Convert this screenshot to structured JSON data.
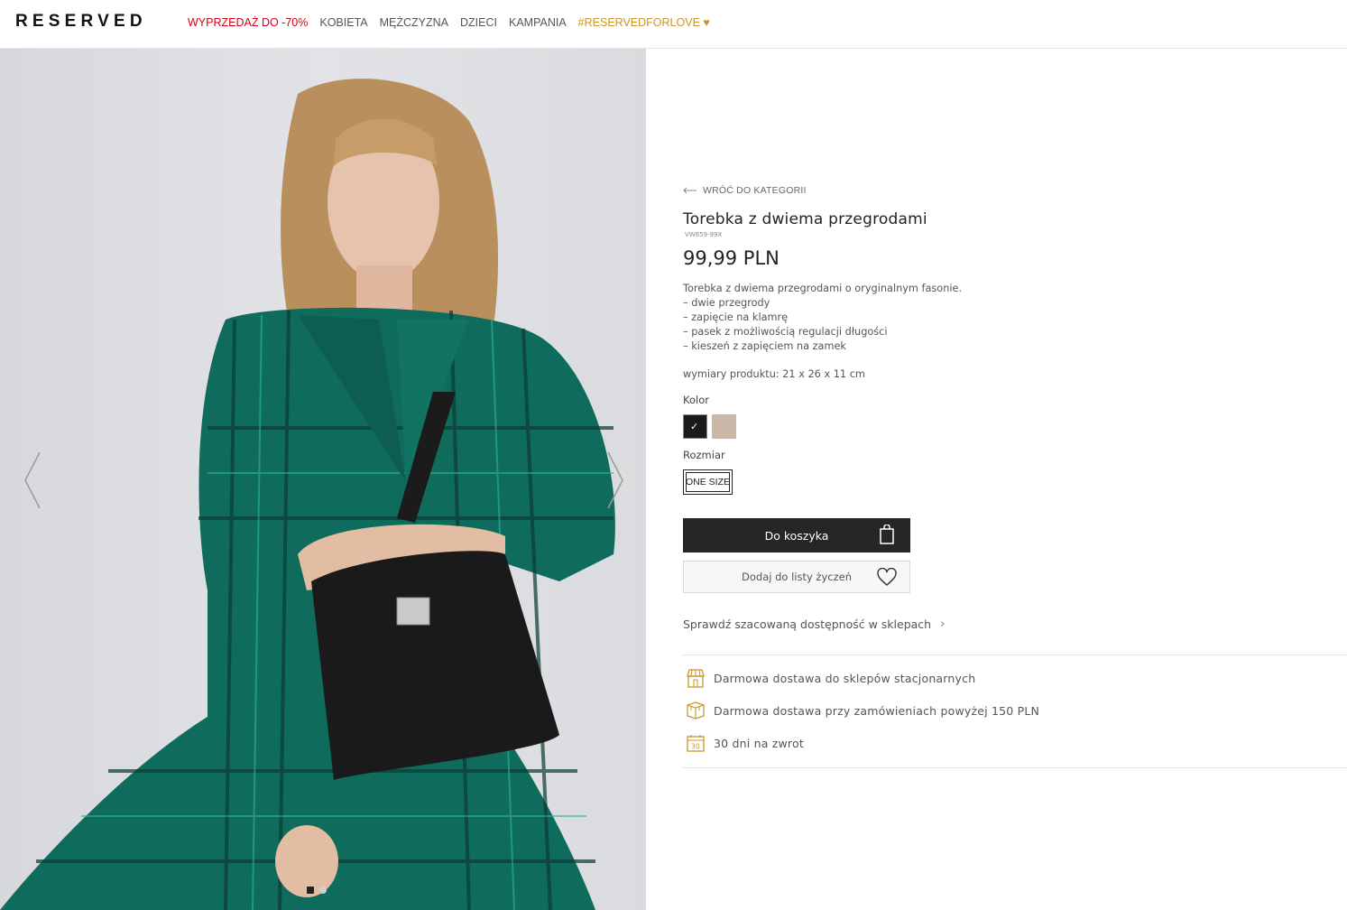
{
  "header": {
    "logo": "RESERVED",
    "nav": [
      {
        "label": "WYPRZEDAŻ DO -70%"
      },
      {
        "label": "KOBIETA"
      },
      {
        "label": "MĘŻCZYZNA"
      },
      {
        "label": "DZIECI"
      },
      {
        "label": "KAMPANIA"
      },
      {
        "label": "#RESERVEDFORLOVE ♥"
      }
    ]
  },
  "product": {
    "back_label": "WRÓĆ DO KATEGORII",
    "title": "Torebka z dwiema przegrodami",
    "sku": "VW659-99X",
    "price": "99,99 PLN",
    "description": [
      "Torebka z dwiema przegrodami o oryginalnym fasonie.",
      "– dwie przegrody",
      "– zapięcie na klamrę",
      "– pasek z możliwością regulacji długości",
      "– kieszeń z zapięciem na zamek"
    ],
    "dimensions": "wymiary produktu: 21 x 26 x 11 cm",
    "color_label": "Kolor",
    "colors": [
      "#1a1a1a",
      "#c9b7a8"
    ],
    "selected_color": 0,
    "size_label": "Rozmiar",
    "size": "ONE SIZE",
    "add_to_cart": "Do koszyka",
    "add_to_wishlist": "Dodaj do listy życzeń",
    "check_availability": "Sprawdź szacowaną dostępność w sklepach"
  },
  "perks": [
    {
      "icon": "store-icon",
      "label": "Darmowa dostawa do sklepów stacjonarnych"
    },
    {
      "icon": "delivery-box-icon",
      "label": "Darmowa dostawa przy zamówieniach powyżej 150 PLN"
    },
    {
      "icon": "calendar-30-icon",
      "label": "30 dni na zwrot",
      "icon_text": "30"
    }
  ],
  "gallery": {
    "image": "model-with-black-handbag",
    "slide_count": 2,
    "active_slide": 0
  },
  "colors": {
    "sale": "#d0021b",
    "love": "#c9962a",
    "cart_button": "#262626",
    "perk_icon": "#c9962a"
  }
}
